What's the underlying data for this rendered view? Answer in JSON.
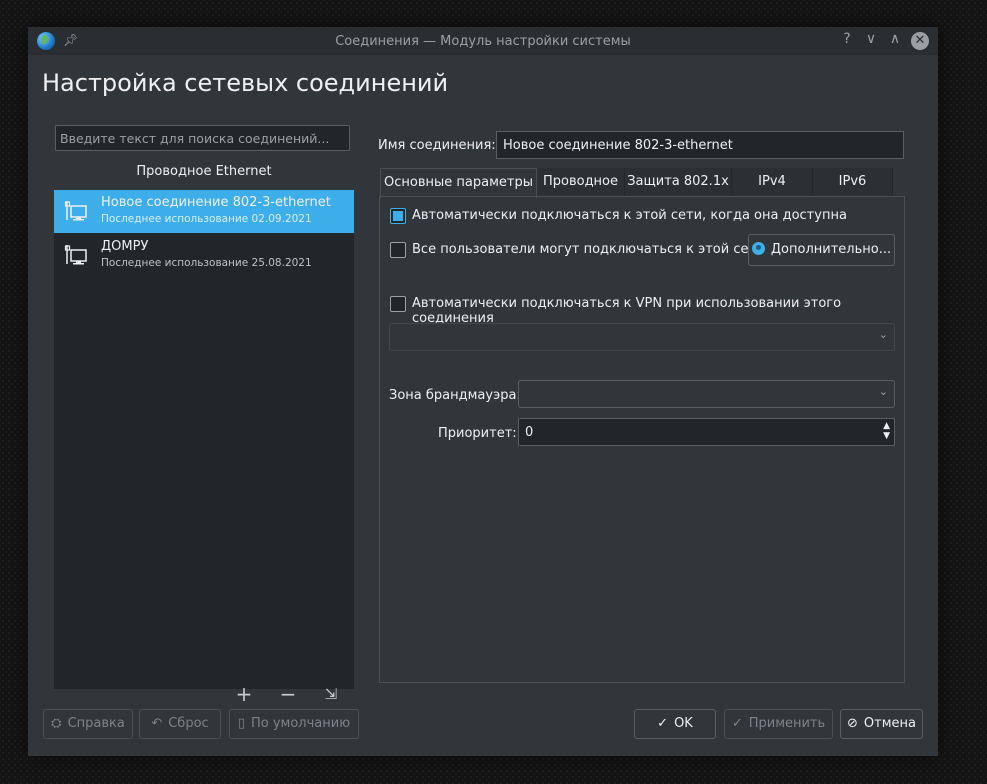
{
  "window": {
    "title": "Соединения — Модуль настройки системы",
    "controls": {
      "help": "?",
      "minimize": "∨",
      "maximize": "∧",
      "close": "✕"
    }
  },
  "page_title": "Настройка сетевых соединений",
  "search": {
    "placeholder": "Введите текст для поиска соединений..."
  },
  "connections": {
    "group": "Проводное Ethernet",
    "items": [
      {
        "name": "Новое соединение 802-3-ethernet",
        "last_used": "Последнее использование 02.09.2021",
        "selected": true
      },
      {
        "name": "ДОМРУ",
        "last_used": "Последнее использование 25.08.2021",
        "selected": false
      }
    ],
    "tools": {
      "add": "+",
      "remove": "−",
      "export": "⇲"
    }
  },
  "editor": {
    "name_label": "Имя соединения:",
    "name_value": "Новое соединение 802-3-ethernet",
    "tabs": [
      "Основные параметры",
      "Проводное",
      "Защита 802.1x",
      "IPv4",
      "IPv6"
    ],
    "active_tab": "Основные параметры",
    "general": {
      "autoconnect_label": "Автоматически подключаться к этой сети, когда она доступна",
      "autoconnect_checked": true,
      "all_users_label": "Все пользователи могут подключаться к этой сети",
      "all_users_checked": false,
      "advanced_button": "Дополнительно...",
      "vpn_label": "Автоматически подключаться к VPN при использовании этого соединения",
      "vpn_checked": false,
      "vpn_select": "",
      "firewall_label": "Зона брандмауэра:",
      "firewall_value": "",
      "priority_label": "Приоритет:",
      "priority_value": "0"
    }
  },
  "footer": {
    "help": "Справка",
    "reset": "Сброс",
    "defaults": "По умолчанию",
    "ok": "OK",
    "apply": "Применить",
    "cancel": "Отмена"
  },
  "colors": {
    "accent": "#3daee9",
    "window_bg": "#31363b",
    "view_bg": "#232629"
  }
}
